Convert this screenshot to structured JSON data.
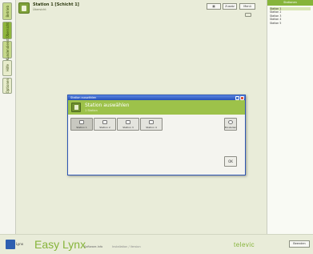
{
  "side_tabs": [
    "Betrieb",
    "Übersicht",
    "Kundendienst",
    "Hilfe",
    "Optionen"
  ],
  "header": {
    "title": "Station 1 [Schicht 1]",
    "subtitle": "Übersicht",
    "buttons": [
      "",
      "Zusatz",
      "Menü"
    ]
  },
  "right_panel": {
    "title": "Stationen",
    "items": [
      "Station 1",
      "Station 2",
      "Station 3",
      "Station 4",
      "Station 5"
    ]
  },
  "dialog": {
    "window_title": "Station auswählen",
    "heading": "Station auswählen",
    "subheading": "1 Station",
    "stations": [
      "Station 1",
      "Station 2",
      "Station 3",
      "Station 4"
    ],
    "settings_label": "Einstellen",
    "ok_label": "OK"
  },
  "footer": {
    "logo_word": "Lynx",
    "app_name": "Easy Lynx",
    "small1": "Software-Info",
    "small2": "Installation / Version",
    "brand": "televic",
    "button": "Beenden"
  },
  "colors": {
    "accent_green": "#86b43a",
    "title_blue": "#2550b8"
  }
}
